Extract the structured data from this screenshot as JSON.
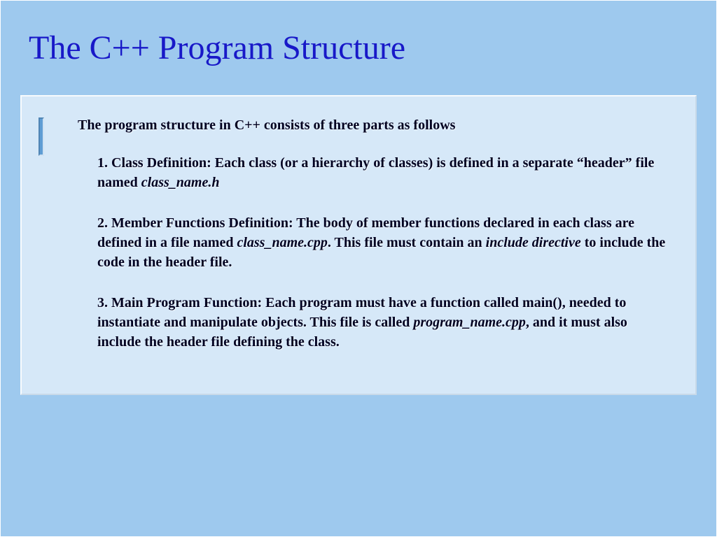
{
  "title": "The C++ Program Structure",
  "intro": "The program structure in C++  consists of three parts as follows",
  "items": [
    {
      "num": "1.",
      "heading": "Class Definition:",
      "body_before": " Each class (or a hierarchy of classes) is defined in a separate “header” file named ",
      "italic1": "class_name.h",
      "body_mid": "",
      "italic2": "",
      "body_after": ""
    },
    {
      "num": "2.",
      "heading": "Member Functions Definition:",
      "body_before": " The body of member functions declared in each class are defined in a file named ",
      "italic1": "class_name.cpp",
      "body_mid": ". This file must contain an ",
      "italic2": "include directive",
      "body_after": " to include the code in the header file."
    },
    {
      "num": "3.",
      "heading": "Main Program Function:",
      "body_before": " Each program must have a function called main(), needed to instantiate and manipulate objects. This file is called ",
      "italic1": "program_name.cpp",
      "body_mid": ", and it must also include the header file defining the class.",
      "italic2": "",
      "body_after": ""
    }
  ]
}
